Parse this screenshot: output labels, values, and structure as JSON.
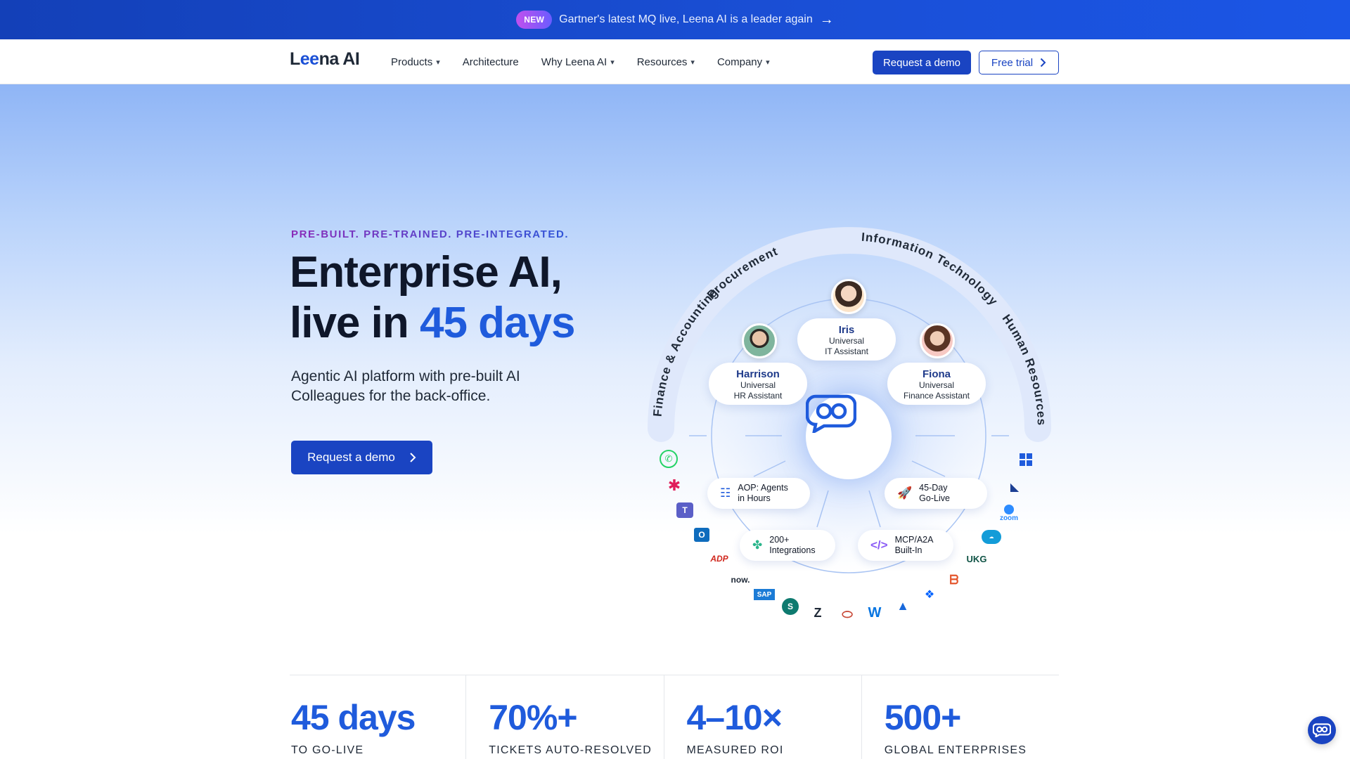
{
  "announcement": {
    "badge": "NEW",
    "message": "Gartner's latest MQ live, Leena AI is a leader again",
    "arrow": "→"
  },
  "nav": {
    "logo_prefix": "L",
    "logo_ee": "ee",
    "logo_suffix": "na AI",
    "menu": [
      {
        "label": "Products",
        "has_dropdown": true
      },
      {
        "label": "Architecture",
        "has_dropdown": false
      },
      {
        "label": "Why Leena AI",
        "has_dropdown": true
      },
      {
        "label": "Resources",
        "has_dropdown": true
      },
      {
        "label": "Company",
        "has_dropdown": true
      }
    ],
    "request_demo": "Request a demo",
    "free_trial": "Free trial"
  },
  "hero": {
    "eyebrow": "PRE-BUILT. PRE-TRAINED. PRE-INTEGRATED.",
    "headline_line1": "Enterprise AI,",
    "headline_line2_prefix": "live in ",
    "headline_line2_accent": "45 days",
    "subtext": "Agentic AI platform with pre-built AI Colleagues for the back-office.",
    "cta": "Request a demo"
  },
  "diagram": {
    "arc_labels": {
      "left": "Finance & Accounting",
      "top_left": "Procurement",
      "top_right": "Information Technology",
      "right": "Human Resources"
    },
    "agents": [
      {
        "name": "Iris",
        "role_line1": "Universal",
        "role_line2": "IT Assistant"
      },
      {
        "name": "Harrison",
        "role_line1": "Universal",
        "role_line2": "HR Assistant"
      },
      {
        "name": "Fiona",
        "role_line1": "Universal",
        "role_line2": "Finance Assistant"
      }
    ],
    "features": [
      {
        "line1": "AOP: Agents",
        "line2": "in Hours",
        "icon": "checklist-icon"
      },
      {
        "line1": "45-Day",
        "line2": "Go-Live",
        "icon": "rocket-icon"
      },
      {
        "line1": "200+",
        "line2": "Integrations",
        "icon": "puzzle-icon"
      },
      {
        "line1": "MCP/A2A",
        "line2": "Built-In",
        "icon": "code-icon"
      }
    ],
    "integrations": [
      "WhatsApp",
      "Slack",
      "Teams",
      "Outlook",
      "ADP",
      "now",
      "SAP",
      "SharePoint",
      "Zendesk",
      "Oracle",
      "Workday",
      "Atlassian",
      "Dropbox",
      "BambooHR",
      "UKG",
      "Salesforce",
      "Zoom",
      "Dynamics",
      "Windows"
    ],
    "integration_texts": {
      "now": "now.",
      "sap": "SAP",
      "ukg": "UKG",
      "zoom": "zoom"
    },
    "colors": {
      "accent": "#1f5bdc",
      "ring": "#a9c4f3"
    }
  },
  "stats": [
    {
      "value": "45 days",
      "label": "TO GO-LIVE"
    },
    {
      "value": "70%+",
      "label": "TICKETS AUTO-RESOLVED"
    },
    {
      "value": "4–10×",
      "label": "MEASURED ROI"
    },
    {
      "value": "500+",
      "label": "GLOBAL ENTERPRISES"
    }
  ]
}
